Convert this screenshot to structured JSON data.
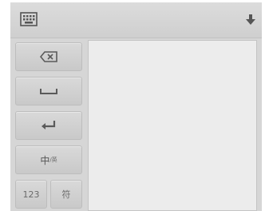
{
  "keys": {
    "lang_key": {
      "main": "中",
      "sub": "/英"
    },
    "num_key": "123",
    "symbol_key": "符"
  },
  "icons": {
    "keyboard": "keyboard-icon",
    "hide": "hide-keyboard-arrow-icon",
    "backspace": "backspace-icon",
    "space": "space-icon",
    "enter": "enter-icon"
  }
}
